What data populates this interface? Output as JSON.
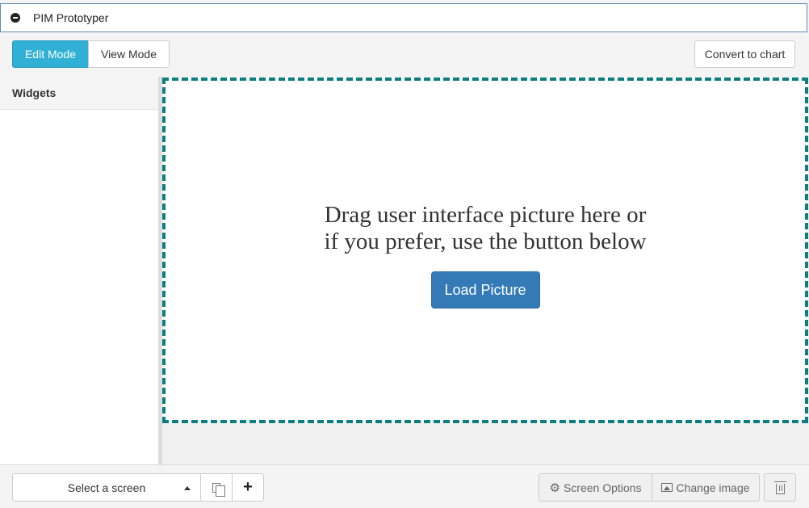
{
  "window": {
    "title": "PIM Prototyper"
  },
  "toolbar": {
    "edit_mode": "Edit Mode",
    "view_mode": "View Mode",
    "convert": "Convert to chart"
  },
  "sidebar": {
    "header": "Widgets"
  },
  "dropzone": {
    "text": "Drag user interface picture here or if you prefer, use the button below",
    "load_button": "Load Picture",
    "border_color": "#0b7f80"
  },
  "footer": {
    "select_screen": "Select a screen",
    "add_label": "+",
    "screen_options": "Screen Options",
    "change_image": "Change image"
  },
  "colors": {
    "edit_mode_active": "#31b0d5",
    "load_button": "#337ab7"
  }
}
